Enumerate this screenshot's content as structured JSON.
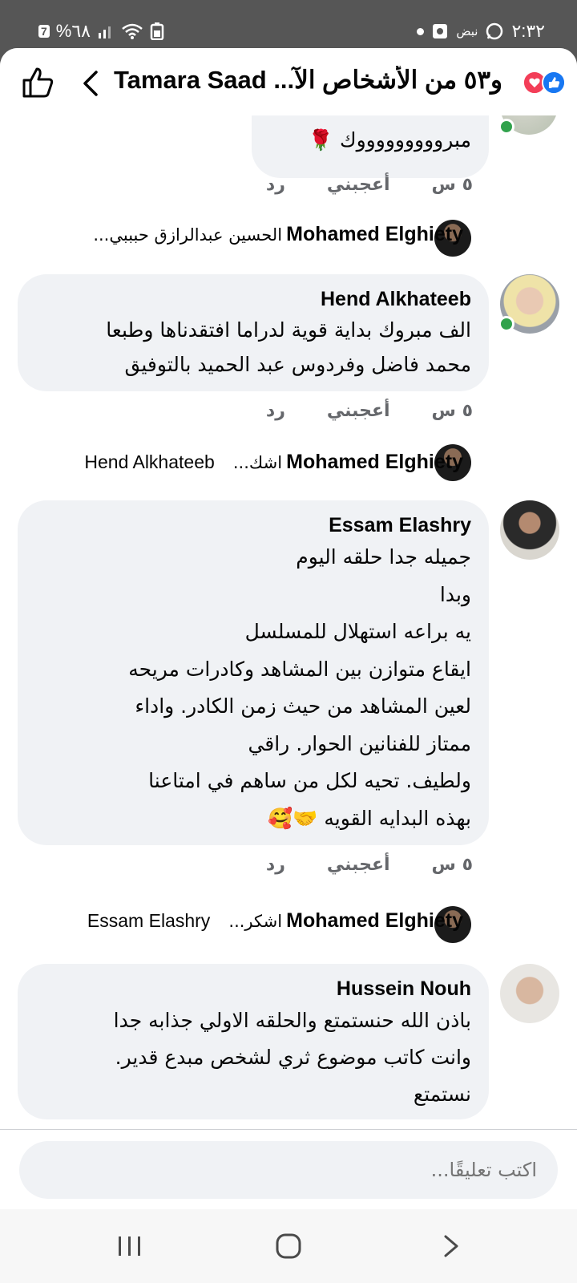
{
  "status_bar": {
    "time": "٢:٣٢",
    "battery": "%٦٨",
    "carrier_tag": "نبض",
    "battery_badge": "7"
  },
  "header": {
    "title": "و٥٣ من الأشخاص الآ... Tamara Saad",
    "reactions": [
      "like-icon",
      "love-icon"
    ],
    "colors": {
      "like": "#1877f2",
      "love": "#f33e58"
    }
  },
  "comments": [
    {
      "name": "",
      "text": "مبروووووووووك 🌹",
      "time": "٥ س",
      "like_label": "أعجبني",
      "reply_label": "رد",
      "online": true
    },
    {
      "name": "Hend Alkhateeb",
      "text": "الف مبروك بداية قوية لدراما افتقدناها وطبعا\nمحمد فاضل وفردوس عبد الحميد بالتوفيق",
      "time": "٥ س",
      "like_label": "أعجبني",
      "reply_label": "رد",
      "online": true
    },
    {
      "name": "Essam Elashry",
      "text": "جميله جدا حلقه اليوم\nوبدا\nيه براعه استهلال للمسلسل\nايقاع متوازن بين المشاهد وكادرات مريحه\nلعين المشاهد من حيث زمن الكادر.       واداء\nممتاز للفنانين          الحوار. راقي\nولطيف.       تحيه لكل من ساهم في امتاعنا\nبهذه البدايه القويه 🤝🥰",
      "time": "٥ س",
      "like_label": "أعجبني",
      "reply_label": "رد",
      "online": false
    },
    {
      "name": "Hussein Nouh",
      "text": "باذن الله حنستمتع والحلقه الاولي جذابه جدا\nوانت كاتب موضوع ثري لشخص مبدع قدير.\nنستمتع",
      "online": false
    }
  ],
  "replies": [
    {
      "name": "Mohamed Elghiety",
      "text": "الحسين عبدالرازق حبببي...",
      "mention": ""
    },
    {
      "name": "Mohamed Elghiety",
      "text": "اشك...",
      "mention": "Hend Alkhateeb"
    },
    {
      "name": "Mohamed Elghiety",
      "text": "اشكر...",
      "mention": "Essam Elashry"
    }
  ],
  "composer": {
    "placeholder": "اكتب تعليقًا..."
  },
  "nav": [
    "recent-apps-icon",
    "home-icon",
    "back-icon"
  ]
}
